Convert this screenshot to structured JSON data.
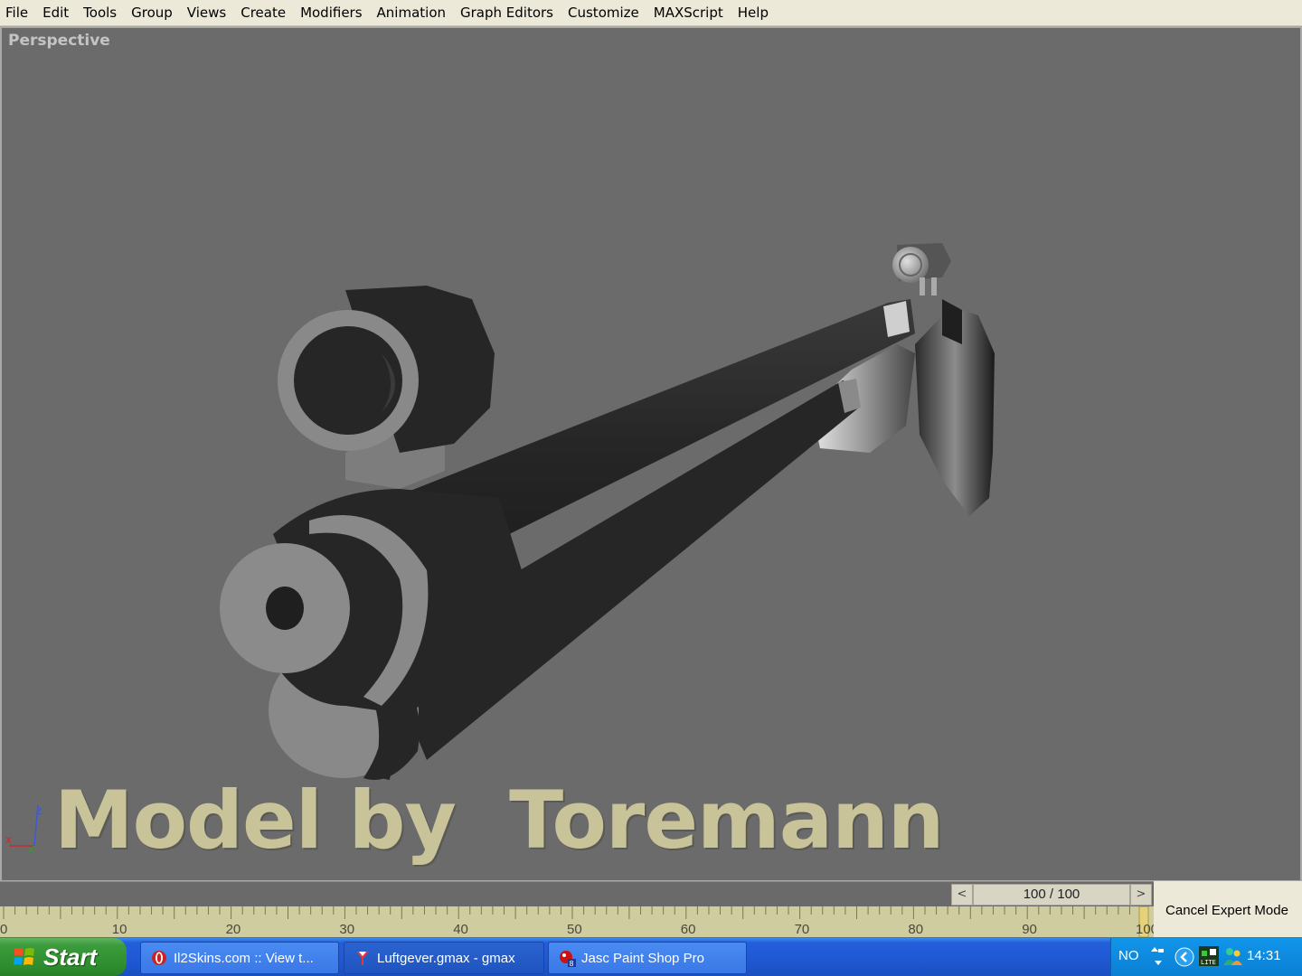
{
  "menu": {
    "items": [
      "File",
      "Edit",
      "Tools",
      "Group",
      "Views",
      "Create",
      "Modifiers",
      "Animation",
      "Graph Editors",
      "Customize",
      "MAXScript",
      "Help"
    ]
  },
  "viewport": {
    "label": "Perspective",
    "watermark": "Model by  Toremann",
    "axis_labels": {
      "x": "x",
      "z": "z"
    }
  },
  "timeline": {
    "frame_display": "100 / 100",
    "prev_symbol": "<",
    "next_symbol": ">",
    "ruler_labels": [
      "0",
      "10",
      "20",
      "30",
      "40",
      "50",
      "60",
      "70",
      "80",
      "90",
      "100"
    ],
    "cancel_expert_label": "Cancel Expert Mode"
  },
  "taskbar": {
    "start_label": "Start",
    "tasks": [
      {
        "label": "Il2Skins.com :: View t...",
        "icon": "opera-icon"
      },
      {
        "label": "Luftgever.gmax - gmax",
        "icon": "gmax-icon"
      },
      {
        "label": "Jasc Paint Shop Pro",
        "icon": "paintshop-icon"
      }
    ],
    "tray": {
      "language": "NO",
      "clock": "14:31"
    }
  },
  "colors": {
    "viewport_bg": "#6b6b6b",
    "menubar_bg": "#ece9d8",
    "watermark": "#c9c39a",
    "taskbar_blue": "#245edb",
    "start_green": "#3b9a3b"
  }
}
